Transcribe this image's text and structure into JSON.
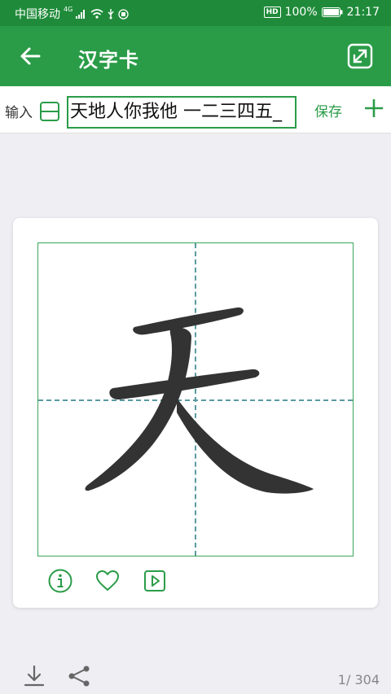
{
  "status_bar": {
    "carrier": "中国移动",
    "network": "4G",
    "battery": "100%",
    "time": "21:17",
    "hd": "HD"
  },
  "app_bar": {
    "title": "汉字卡",
    "back_icon": "arrow-left-icon",
    "fullscreen_icon": "expand-icon"
  },
  "input_bar": {
    "label": "输入",
    "value": "天地人你我他 一二三四五_",
    "save_label": "保存",
    "layout_icon": "split-layout-icon",
    "add_icon": "plus-icon"
  },
  "card": {
    "character": "天",
    "actions": [
      "info-icon",
      "heart-icon",
      "play-icon"
    ]
  },
  "footer": {
    "page_counter": "1/ 304"
  },
  "colors": {
    "status_bar": "#1f8b3a",
    "accent": "#2a9c48",
    "grid_border": "#3aa55a",
    "guide_line": "#5a9aa0",
    "character": "#333333",
    "background": "#eeeef3"
  }
}
